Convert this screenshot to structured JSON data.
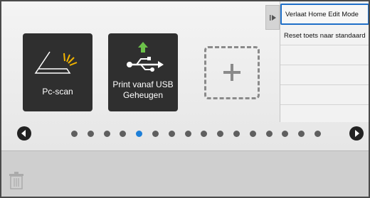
{
  "tiles": [
    {
      "label": "Pc-scan",
      "icon": "scanner-icon"
    },
    {
      "label": "Print vanaf USB\nGeheugen",
      "icon": "usb-print-icon"
    }
  ],
  "add_tile": {
    "icon": "plus-icon"
  },
  "pagination": {
    "total": 16,
    "active_index": 4
  },
  "side_menu": {
    "items": [
      {
        "label": "Verlaat Home Edit Mode"
      },
      {
        "label": "Reset toets naar standaard"
      }
    ]
  },
  "colors": {
    "accent": "#1e7fd8",
    "tile_bg": "#2f2f2f",
    "highlight_border": "#1f6fc8"
  }
}
